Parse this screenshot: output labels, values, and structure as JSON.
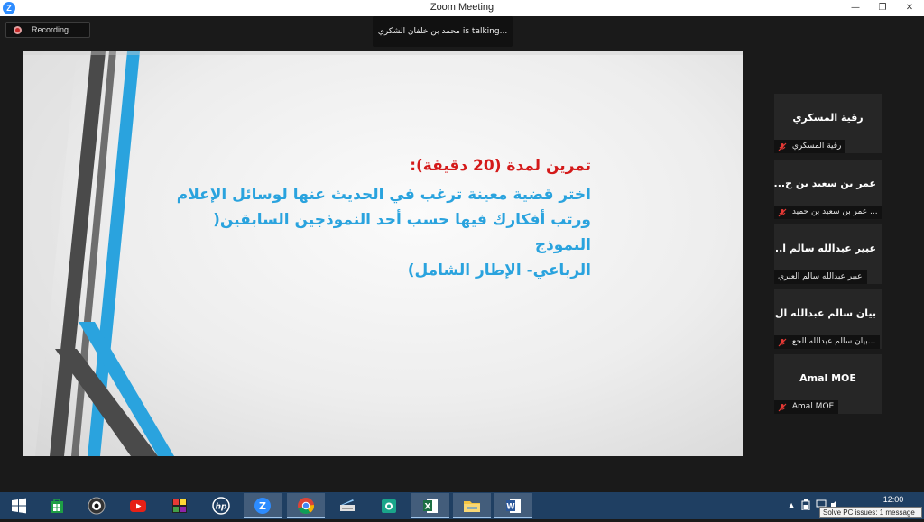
{
  "window": {
    "title": "Zoom Meeting",
    "logo_letter": "Z",
    "minimize_glyph": "—",
    "restore_glyph": "❐",
    "close_glyph": "✕"
  },
  "meeting": {
    "recording_label": "Recording...",
    "talking_text": "محمد بن خلفان الشكري is talking..."
  },
  "slide": {
    "heading": "تمرين  لمدة (20 دقيقة):",
    "body_line1": "اختر قضية معينة ترغب في الحديث عنها لوسائل الإعلام",
    "body_line2": "ورتب أفكارك فيها حسب أحد النموذجين السابقين( النموذج",
    "body_line3": "الرباعي- الإطار الشامل)"
  },
  "participants": [
    {
      "display_name": "رقية المسكري",
      "label": "رقية المسكري",
      "muted": true
    },
    {
      "display_name": "عمر بن سعيد بن ح...",
      "label": "عمر بن سعيد بن حميد ...",
      "muted": true
    },
    {
      "display_name": "عبير عبدالله سالم ا...",
      "label": "عبير عبدالله سالم العبري",
      "muted": false
    },
    {
      "display_name": "بيان سالم عبدالله ال...",
      "label": "بيان سالم عبدالله الجع...",
      "muted": true
    },
    {
      "display_name": "Amal MOE",
      "label": "Amal MOE",
      "muted": true
    }
  ],
  "taskbar": {
    "apps": [
      {
        "name": "store",
        "icon": "store-icon",
        "active": false
      },
      {
        "name": "webcam",
        "icon": "webcam-icon",
        "active": false
      },
      {
        "name": "youtube",
        "icon": "youtube-icon",
        "active": false
      },
      {
        "name": "photos",
        "icon": "photos-icon",
        "active": false
      },
      {
        "name": "hp",
        "icon": "hp-icon",
        "active": false
      },
      {
        "name": "zoom",
        "icon": "zoom-icon",
        "active": true
      },
      {
        "name": "chrome",
        "icon": "chrome-icon",
        "active": true
      },
      {
        "name": "scanner",
        "icon": "scanner-icon",
        "active": false
      },
      {
        "name": "camera-app",
        "icon": "camera-icon",
        "active": false
      },
      {
        "name": "excel",
        "icon": "excel-icon",
        "active": true
      },
      {
        "name": "file-explorer",
        "icon": "folder-icon",
        "active": true
      },
      {
        "name": "word",
        "icon": "word-icon",
        "active": true
      }
    ],
    "clock_time": "12:00",
    "tooltip": "Solve PC issues: 1 message"
  },
  "colors": {
    "slide_heading": "#d41a1a",
    "slide_body": "#2aa3de",
    "taskbar": "#1f3f62",
    "zoom_blue": "#2d8cff"
  }
}
